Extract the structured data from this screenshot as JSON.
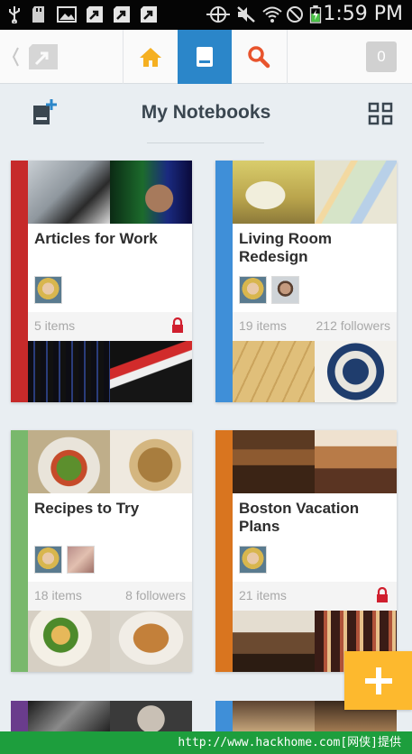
{
  "status_bar": {
    "time": "1:59 PM",
    "icons": [
      "usb-icon",
      "sd-card-icon",
      "image-icon",
      "evernote-clipper-icon",
      "evernote-clipper-icon",
      "evernote-clipper-icon",
      "rotation-icon",
      "mute-icon",
      "wifi-icon",
      "no-signal-icon",
      "battery-charging-icon"
    ]
  },
  "nav": {
    "back_icon": "back-chevron-icon",
    "tabs": [
      {
        "name": "home",
        "icon": "home-icon",
        "color": "#f5b021"
      },
      {
        "name": "notebooks",
        "icon": "notebook-icon",
        "active": true
      },
      {
        "name": "search",
        "icon": "search-icon",
        "color": "#e8542d"
      }
    ],
    "badge_count": "0"
  },
  "header": {
    "title": "My Notebooks",
    "new_notebook_icon": "new-notebook-icon",
    "grid_icon": "grid-view-icon"
  },
  "notebooks": [
    {
      "title": "Articles for Work",
      "items": "5 items",
      "followers": "",
      "locked": true,
      "stripe": "#c62a2a",
      "avatars": 1
    },
    {
      "title": "Living Room Redesign",
      "items": "19 items",
      "followers": "212 followers",
      "locked": false,
      "stripe": "#3f8fd8",
      "avatars": 2
    },
    {
      "title": "Recipes to Try",
      "items": "18 items",
      "followers": "8 followers",
      "locked": false,
      "stripe": "#79b86c",
      "avatars": 2
    },
    {
      "title": "Boston Vacation Plans",
      "items": "21 items",
      "followers": "",
      "locked": true,
      "stripe": "#d9751f",
      "avatars": 1
    }
  ],
  "fab": {
    "icon": "plus-icon"
  },
  "watermark": "http://www.hackhome.com[网侠]提供"
}
